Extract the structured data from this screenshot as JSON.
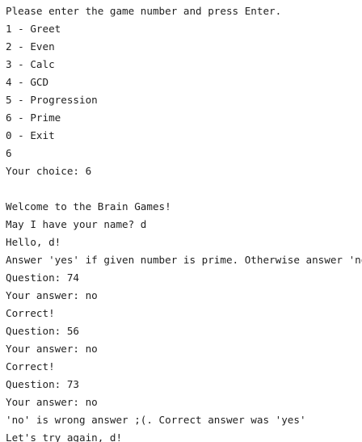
{
  "console": {
    "lines": [
      "Please enter the game number and press Enter.",
      "1 - Greet",
      "2 - Even",
      "3 - Calc",
      "4 - GCD",
      "5 - Progression",
      "6 - Prime",
      "0 - Exit",
      "6",
      "Your choice: 6",
      "",
      "Welcome to the Brain Games!",
      "May I have your name? d",
      "Hello, d!",
      "Answer 'yes' if given number is prime. Otherwise answer 'no'.",
      "Question: 74",
      "Your answer: no",
      "Correct!",
      "Question: 56",
      "Your answer: no",
      "Correct!",
      "Question: 73",
      "Your answer: no",
      "'no' is wrong answer ;(. Correct answer was 'yes'",
      "Let's try again, d!"
    ]
  }
}
